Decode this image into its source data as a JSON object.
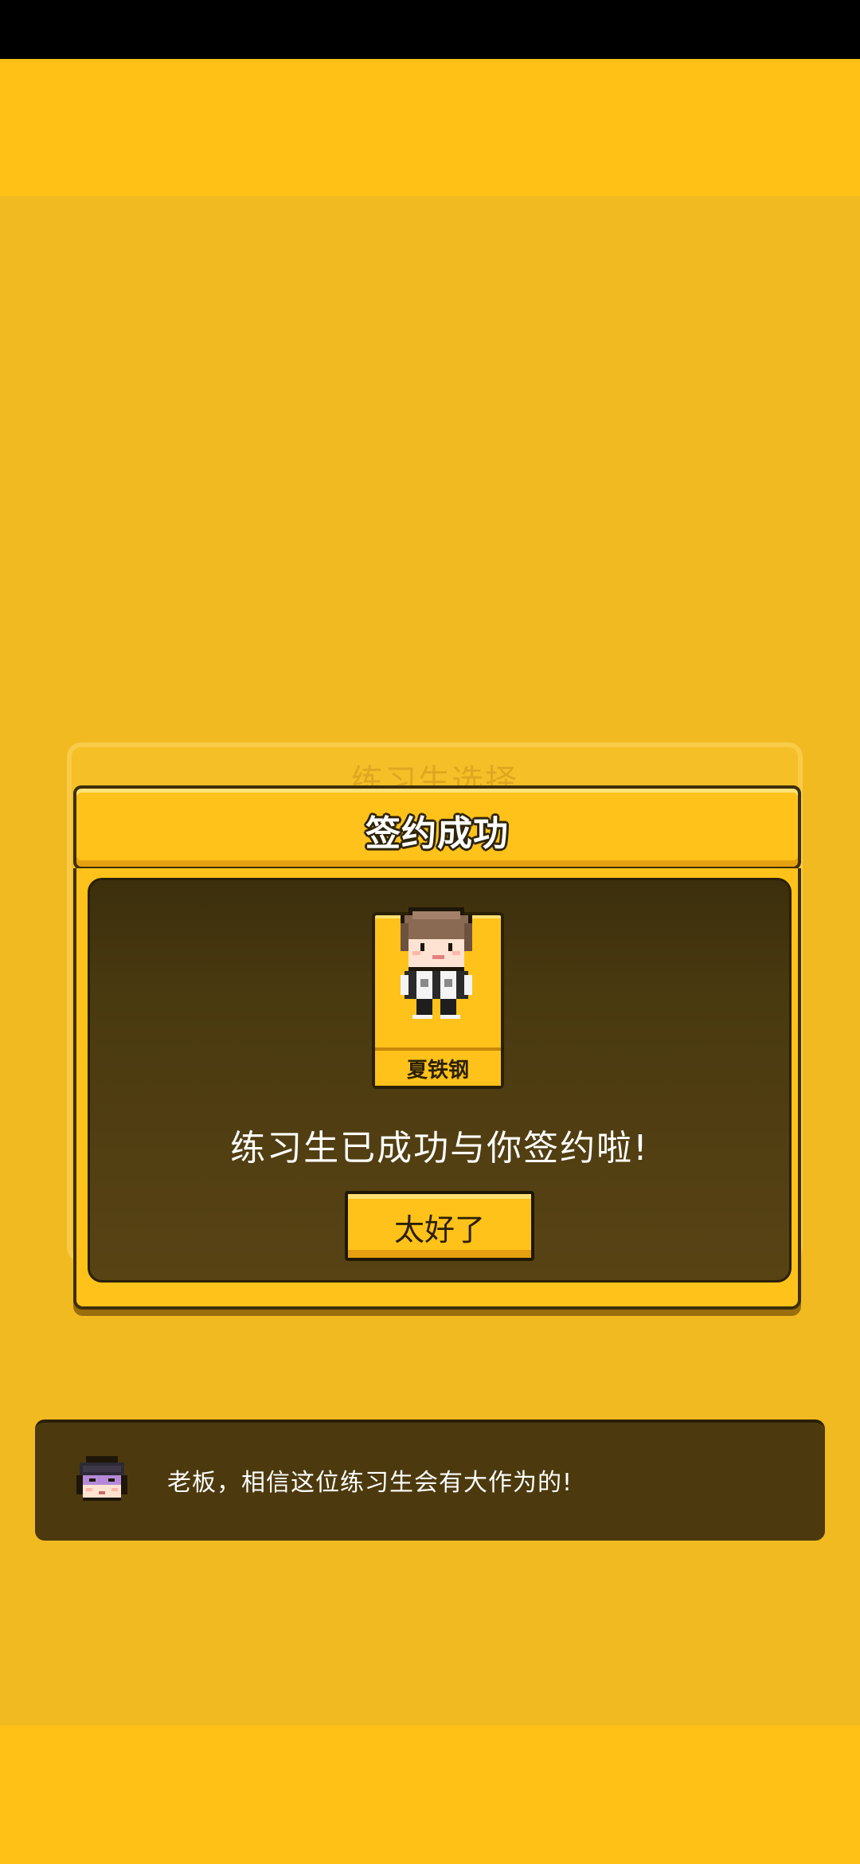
{
  "background_dialog": {
    "title": "练习生选择"
  },
  "modal": {
    "title": "签约成功",
    "character": {
      "name": "夏铁钢",
      "avatar_icon": "trainee-pixel-avatar"
    },
    "message": "练习生已成功与你签约啦!",
    "confirm_label": "太好了"
  },
  "advisor": {
    "avatar_icon": "boss-pixel-avatar",
    "message": "老板，相信这位练习生会有大作为的!"
  },
  "colors": {
    "background": "#f2ba21",
    "band": "#ffc116",
    "panel_dark": "#4a3a10",
    "accent_yellow": "#ffc21a",
    "outline": "#2a2006"
  }
}
